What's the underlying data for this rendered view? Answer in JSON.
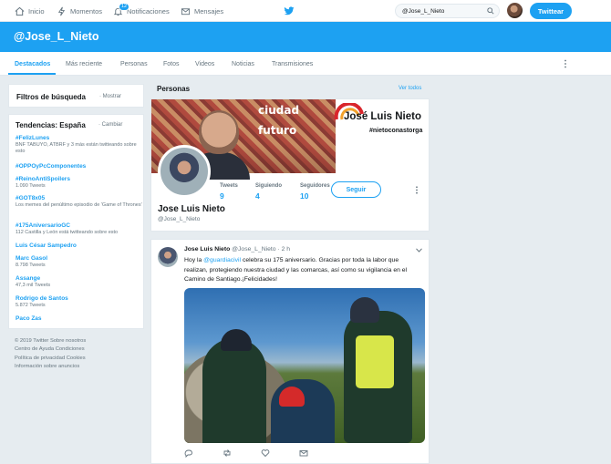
{
  "nav": {
    "home": "Inicio",
    "moments": "Momentos",
    "notifications": "Notificaciones",
    "notifications_count": "12",
    "messages": "Mensajes",
    "search_value": "@Jose_L_Nieto",
    "tweet_button": "Twittear"
  },
  "profile_header": {
    "handle": "@Jose_L_Nieto"
  },
  "tabs": [
    "Destacados",
    "Más reciente",
    "Personas",
    "Fotos",
    "Videos",
    "Noticias",
    "Transmisiones"
  ],
  "filters": {
    "title": "Filtros de búsqueda",
    "link": "· Mostrar"
  },
  "trends": {
    "title": "Tendencias: España",
    "change": "· Cambiar",
    "items": [
      {
        "name": "#FelizLunes",
        "meta": "BNF TABUYO, ATBRF y 3 más están twitteando sobre esto"
      },
      {
        "name": "#OPPOyPcComponentes",
        "meta": ""
      },
      {
        "name": "#ReinoAntiSpoilers",
        "meta": "1.090 Tweets"
      },
      {
        "name": "#GOT8x05",
        "meta": "Los memes del penúltimo episodio de 'Game of Thrones'"
      },
      {
        "name": "#175AniversarioGC",
        "meta": "112 Castilla y León está twitteando sobre esto"
      },
      {
        "name": "Luis César Sampedro",
        "meta": ""
      },
      {
        "name": "Marc Gasol",
        "meta": "8.798 Tweets"
      },
      {
        "name": "Assange",
        "meta": "47,3 mil Tweets"
      },
      {
        "name": "Rodrigo de Santos",
        "meta": "5.872 Tweets"
      },
      {
        "name": "Paco Zas",
        "meta": ""
      }
    ]
  },
  "footer": {
    "lines": [
      "© 2019 Twitter   Sobre nosotros",
      "Centro de Ayuda   Condiciones",
      "Política de privacidad   Cookies",
      "Información sobre anuncios"
    ]
  },
  "personas": {
    "label": "Personas",
    "see_all": "Ver todos",
    "card": {
      "banner_text_1": "ciudad",
      "banner_text_2": "futuro",
      "banner_name": "José Luis Nieto",
      "banner_tag": "#nietoconastorga",
      "name": "Jose Luis Nieto",
      "handle": "@Jose_L_Nieto",
      "stats": [
        {
          "label": "Tweets",
          "value": "9"
        },
        {
          "label": "Siguiendo",
          "value": "4"
        },
        {
          "label": "Seguidores",
          "value": "10"
        }
      ],
      "follow_button": "Seguir"
    }
  },
  "tweet": {
    "name": "Jose Luis Nieto",
    "handle": "@Jose_L_Nieto",
    "time": "· 2 h",
    "text_pre": "Hoy la ",
    "mention": "@guardiacivil",
    "text_post": " celebra su 175 aniversario. Gracias por toda la labor que realizan, protegiendo nuestra ciudad y las comarcas, así como su vigilancia en el Camino de Santiago.¡Felicidades!"
  },
  "colors": {
    "brand": "#1da1f2",
    "background": "#e6ecf0",
    "text": "#14171a",
    "muted": "#66757f"
  },
  "icons": [
    "home-icon",
    "lightning-icon",
    "bell-icon",
    "envelope-icon",
    "twitter-bird-icon",
    "search-icon",
    "more-vertical-icon",
    "reply-icon",
    "retweet-icon",
    "like-icon",
    "dm-icon",
    "chevron-down-icon"
  ]
}
